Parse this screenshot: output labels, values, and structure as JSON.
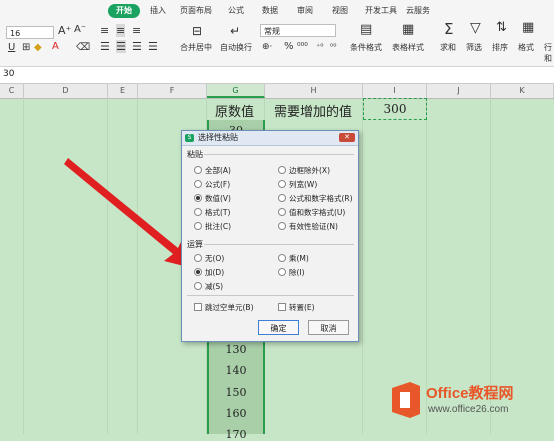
{
  "ribbon": {
    "tabs": [
      "开始",
      "插入",
      "页面布局",
      "公式",
      "数据",
      "审阅",
      "视图",
      "开发工具",
      "云服务"
    ],
    "font_size": "16",
    "number_format": "常规",
    "buttons": {
      "merge_center": "合并居中",
      "wrap_text": "自动换行",
      "conditional_format": "条件格式",
      "table_style": "表格样式",
      "sum": "求和",
      "filter": "筛选",
      "sort": "排序",
      "format": "格式",
      "row_col": "行和"
    }
  },
  "formula_bar": {
    "value": "30"
  },
  "columns": [
    "C",
    "D",
    "E",
    "F",
    "G",
    "H",
    "I",
    "J",
    "K"
  ],
  "sheet": {
    "header_g": "原数值",
    "header_h": "需要增加的值",
    "i_value": "300",
    "g_values_top": "30",
    "g_values_bottom": [
      "130",
      "140",
      "150",
      "160",
      "170"
    ]
  },
  "dialog": {
    "title": "选择性粘贴",
    "close_label": "✕",
    "paste_section": "粘贴",
    "paste_options_left": [
      "全部(A)",
      "公式(F)",
      "数值(V)",
      "格式(T)",
      "批注(C)"
    ],
    "paste_options_right": [
      "边框除外(X)",
      "列宽(W)",
      "公式和数字格式(R)",
      "值和数字格式(U)",
      "有效性验证(N)"
    ],
    "paste_selected": "数值(V)",
    "op_section": "运算",
    "op_left": [
      "无(O)",
      "加(D)",
      "减(S)"
    ],
    "op_right": [
      "乘(M)",
      "除(I)"
    ],
    "op_selected": "加(D)",
    "skip_blanks": "跳过空单元(B)",
    "transpose": "转置(E)",
    "ok": "确定",
    "cancel": "取消"
  },
  "brand": {
    "name": "Office教程网",
    "url": "www.office26.com"
  },
  "colors": {
    "accent": "#1aa260",
    "arrow": "#e02020",
    "logo_orange": "#e8572a"
  }
}
